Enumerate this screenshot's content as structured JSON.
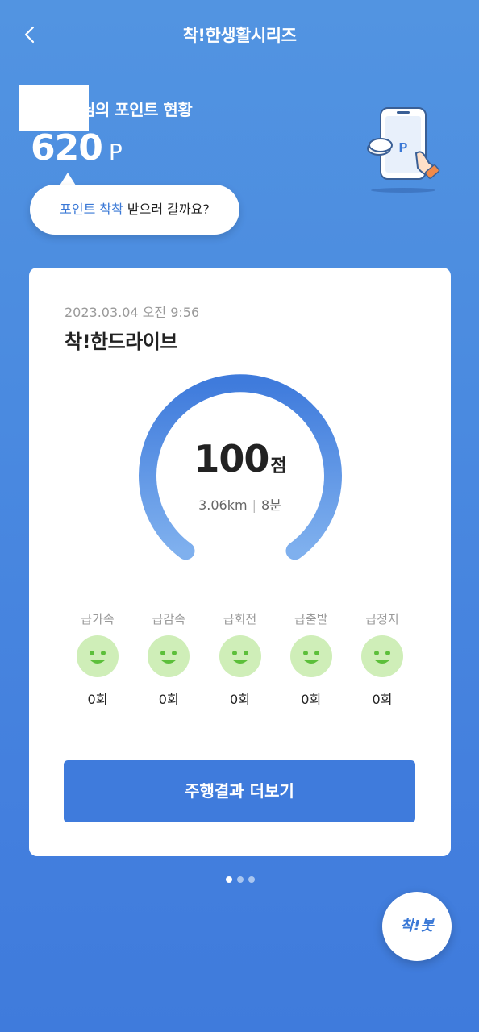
{
  "header": {
    "title": "착!한생활시리즈"
  },
  "points": {
    "label": "님의 포인트 현황",
    "value": "620",
    "unit": "P"
  },
  "bubble": {
    "highlight": "포인트 착착",
    "rest": " 받으러 갈까요?"
  },
  "card": {
    "date": "2023.03.04 오전 9:56",
    "title": "착!한드라이브",
    "score": "100",
    "score_unit": "점",
    "distance": "3.06km",
    "separator": "|",
    "duration": "8분",
    "events": [
      {
        "label": "급가속",
        "count": "0회"
      },
      {
        "label": "급감속",
        "count": "0회"
      },
      {
        "label": "급회전",
        "count": "0회"
      },
      {
        "label": "급출발",
        "count": "0회"
      },
      {
        "label": "급정지",
        "count": "0회"
      }
    ],
    "button_label": "주행결과 더보기"
  },
  "pagination": {
    "total": 3,
    "active": 1
  },
  "fab": {
    "label": "착!봇"
  },
  "colors": {
    "accent": "#3f7bdc",
    "face_bg": "#cfeeb8",
    "face_fg": "#5cbf3a"
  }
}
